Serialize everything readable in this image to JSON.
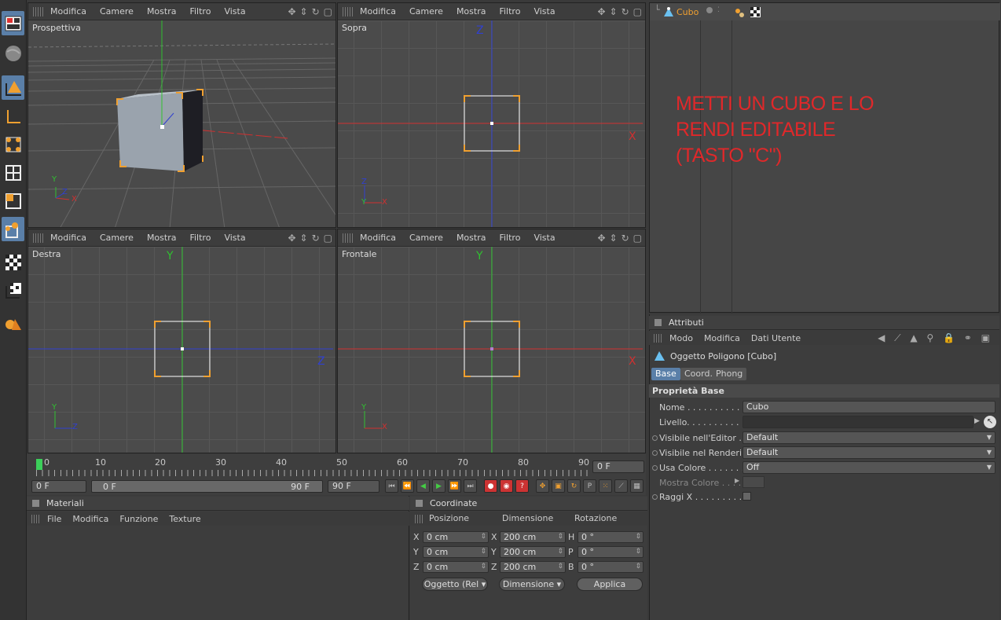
{
  "viewport_menu": [
    "Modifica",
    "Camere",
    "Mostra",
    "Filtro",
    "Vista"
  ],
  "viewports": {
    "perspective": "Prospettiva",
    "top": "Sopra",
    "right": "Destra",
    "front": "Frontale"
  },
  "axis_letters": {
    "x": "X",
    "y": "Y",
    "z": "Z"
  },
  "object_manager": {
    "object_name": "Cubo"
  },
  "annotation": {
    "lines": [
      "METTI UN CUBO E LO",
      "RENDI EDITABILE",
      "(TASTO \"C\")"
    ],
    "color": "#e0282a"
  },
  "timeline": {
    "ticks": [
      "0",
      "10",
      "20",
      "30",
      "40",
      "50",
      "60",
      "70",
      "80",
      "90"
    ],
    "current_frame": "0 F",
    "start_field": "0 F",
    "range_start": "0 F",
    "range_end": "90 F",
    "end_field": "90 F"
  },
  "materials": {
    "title": "Materiali",
    "menu": [
      "File",
      "Modifica",
      "Funzione",
      "Texture"
    ]
  },
  "coordinates": {
    "title": "Coordinate",
    "headers": [
      "Posizione",
      "Dimensione",
      "Rotazione"
    ],
    "position": [
      {
        "axis": "X",
        "value": "0 cm"
      },
      {
        "axis": "Y",
        "value": "0 cm"
      },
      {
        "axis": "Z",
        "value": "0 cm"
      }
    ],
    "size": [
      {
        "axis": "X",
        "value": "200 cm"
      },
      {
        "axis": "Y",
        "value": "200 cm"
      },
      {
        "axis": "Z",
        "value": "200 cm"
      }
    ],
    "rotation": [
      {
        "axis": "H",
        "value": "0 °"
      },
      {
        "axis": "P",
        "value": "0 °"
      },
      {
        "axis": "B",
        "value": "0 °"
      }
    ],
    "mode_dropdown": "Oggetto (Rel",
    "size_dropdown": "Dimensione",
    "apply_button": "Applica"
  },
  "attributes": {
    "title": "Attributi",
    "menu": [
      "Modo",
      "Modifica",
      "Dati Utente"
    ],
    "object_title": "Oggetto Poligono [Cubo]",
    "tabs": [
      "Base",
      "Coord.",
      "Phong"
    ],
    "section": "Proprietà Base",
    "rows": {
      "name_label": "Nome . . . . . . . . . . .",
      "name_value": "Cubo",
      "layer_label": "Livello. . . . . . . . . . .",
      "vis_editor_label": "Visibile nell'Editor . . .",
      "vis_editor_value": "Default",
      "vis_render_label": "Visibile nel Rendering",
      "vis_render_value": "Default",
      "use_color_label": "Usa Colore . . . . . . . .",
      "use_color_value": "Off",
      "show_color_label": "Mostra Colore . . . .",
      "xray_label": "Raggi X . . . . . . . . . ."
    }
  },
  "colors": {
    "selection": "#f0a030",
    "axis_x": "#d03030",
    "axis_y": "#30c030",
    "axis_z": "#3040d0",
    "active_tab": "#5a7fa8"
  }
}
